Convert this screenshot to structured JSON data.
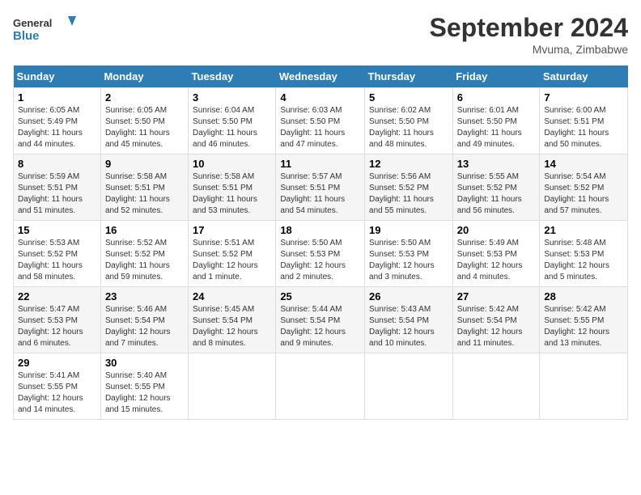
{
  "header": {
    "logo_line1": "General",
    "logo_line2": "Blue",
    "month_year": "September 2024",
    "location": "Mvuma, Zimbabwe"
  },
  "days_of_week": [
    "Sunday",
    "Monday",
    "Tuesday",
    "Wednesday",
    "Thursday",
    "Friday",
    "Saturday"
  ],
  "weeks": [
    [
      {
        "day": 1,
        "sunrise": "6:05 AM",
        "sunset": "5:49 PM",
        "daylight": "11 hours and 44 minutes."
      },
      {
        "day": 2,
        "sunrise": "6:05 AM",
        "sunset": "5:50 PM",
        "daylight": "11 hours and 45 minutes."
      },
      {
        "day": 3,
        "sunrise": "6:04 AM",
        "sunset": "5:50 PM",
        "daylight": "11 hours and 46 minutes."
      },
      {
        "day": 4,
        "sunrise": "6:03 AM",
        "sunset": "5:50 PM",
        "daylight": "11 hours and 47 minutes."
      },
      {
        "day": 5,
        "sunrise": "6:02 AM",
        "sunset": "5:50 PM",
        "daylight": "11 hours and 48 minutes."
      },
      {
        "day": 6,
        "sunrise": "6:01 AM",
        "sunset": "5:50 PM",
        "daylight": "11 hours and 49 minutes."
      },
      {
        "day": 7,
        "sunrise": "6:00 AM",
        "sunset": "5:51 PM",
        "daylight": "11 hours and 50 minutes."
      }
    ],
    [
      {
        "day": 8,
        "sunrise": "5:59 AM",
        "sunset": "5:51 PM",
        "daylight": "11 hours and 51 minutes."
      },
      {
        "day": 9,
        "sunrise": "5:58 AM",
        "sunset": "5:51 PM",
        "daylight": "11 hours and 52 minutes."
      },
      {
        "day": 10,
        "sunrise": "5:58 AM",
        "sunset": "5:51 PM",
        "daylight": "11 hours and 53 minutes."
      },
      {
        "day": 11,
        "sunrise": "5:57 AM",
        "sunset": "5:51 PM",
        "daylight": "11 hours and 54 minutes."
      },
      {
        "day": 12,
        "sunrise": "5:56 AM",
        "sunset": "5:52 PM",
        "daylight": "11 hours and 55 minutes."
      },
      {
        "day": 13,
        "sunrise": "5:55 AM",
        "sunset": "5:52 PM",
        "daylight": "11 hours and 56 minutes."
      },
      {
        "day": 14,
        "sunrise": "5:54 AM",
        "sunset": "5:52 PM",
        "daylight": "11 hours and 57 minutes."
      }
    ],
    [
      {
        "day": 15,
        "sunrise": "5:53 AM",
        "sunset": "5:52 PM",
        "daylight": "11 hours and 58 minutes."
      },
      {
        "day": 16,
        "sunrise": "5:52 AM",
        "sunset": "5:52 PM",
        "daylight": "11 hours and 59 minutes."
      },
      {
        "day": 17,
        "sunrise": "5:51 AM",
        "sunset": "5:52 PM",
        "daylight": "12 hours and 1 minute."
      },
      {
        "day": 18,
        "sunrise": "5:50 AM",
        "sunset": "5:53 PM",
        "daylight": "12 hours and 2 minutes."
      },
      {
        "day": 19,
        "sunrise": "5:50 AM",
        "sunset": "5:53 PM",
        "daylight": "12 hours and 3 minutes."
      },
      {
        "day": 20,
        "sunrise": "5:49 AM",
        "sunset": "5:53 PM",
        "daylight": "12 hours and 4 minutes."
      },
      {
        "day": 21,
        "sunrise": "5:48 AM",
        "sunset": "5:53 PM",
        "daylight": "12 hours and 5 minutes."
      }
    ],
    [
      {
        "day": 22,
        "sunrise": "5:47 AM",
        "sunset": "5:53 PM",
        "daylight": "12 hours and 6 minutes."
      },
      {
        "day": 23,
        "sunrise": "5:46 AM",
        "sunset": "5:54 PM",
        "daylight": "12 hours and 7 minutes."
      },
      {
        "day": 24,
        "sunrise": "5:45 AM",
        "sunset": "5:54 PM",
        "daylight": "12 hours and 8 minutes."
      },
      {
        "day": 25,
        "sunrise": "5:44 AM",
        "sunset": "5:54 PM",
        "daylight": "12 hours and 9 minutes."
      },
      {
        "day": 26,
        "sunrise": "5:43 AM",
        "sunset": "5:54 PM",
        "daylight": "12 hours and 10 minutes."
      },
      {
        "day": 27,
        "sunrise": "5:42 AM",
        "sunset": "5:54 PM",
        "daylight": "12 hours and 11 minutes."
      },
      {
        "day": 28,
        "sunrise": "5:42 AM",
        "sunset": "5:55 PM",
        "daylight": "12 hours and 13 minutes."
      }
    ],
    [
      {
        "day": 29,
        "sunrise": "5:41 AM",
        "sunset": "5:55 PM",
        "daylight": "12 hours and 14 minutes."
      },
      {
        "day": 30,
        "sunrise": "5:40 AM",
        "sunset": "5:55 PM",
        "daylight": "12 hours and 15 minutes."
      },
      null,
      null,
      null,
      null,
      null
    ]
  ]
}
